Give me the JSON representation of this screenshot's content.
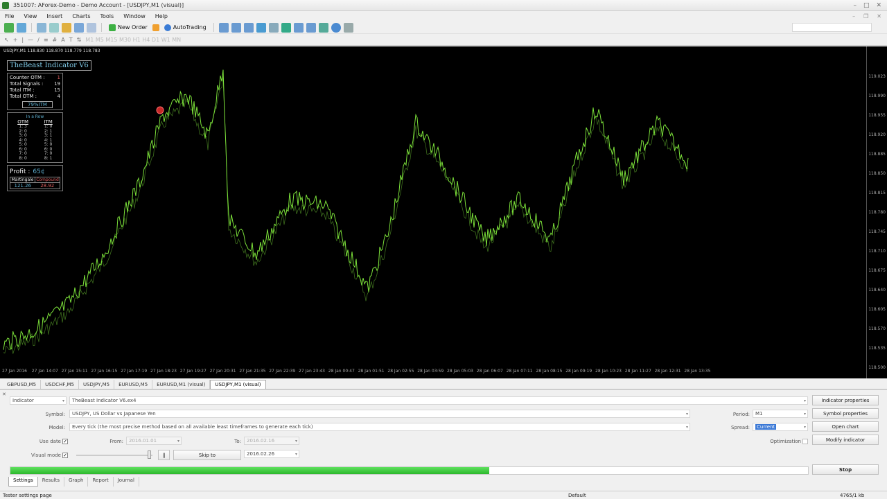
{
  "window": {
    "title": "351007: AForex-Demo - Demo Account - [USDJPY,M1 (visual)]"
  },
  "menu": [
    "File",
    "View",
    "Insert",
    "Charts",
    "Tools",
    "Window",
    "Help"
  ],
  "toolbar": {
    "new_order": "New Order",
    "autotrading": "AutoTrading"
  },
  "chart": {
    "title": "USDJPY,M1  118.830 118.870 118.779 118.783",
    "price_labels": [
      "119.023",
      "118.990",
      "118.955",
      "118.920",
      "118.885",
      "118.850",
      "118.815",
      "118.780",
      "118.745",
      "118.710",
      "118.675",
      "118.640",
      "118.605",
      "118.570",
      "118.535",
      "118.500"
    ],
    "time_labels": [
      "27 Jan 2016",
      "27 Jan 14:07",
      "27 Jan 15:11",
      "27 Jan 16:15",
      "27 Jan 17:19",
      "27 Jan 18:23",
      "27 Jan 19:27",
      "27 Jan 20:31",
      "27 Jan 21:35",
      "27 Jan 22:39",
      "27 Jan 23:43",
      "28 Jan 00:47",
      "28 Jan 01:51",
      "28 Jan 02:55",
      "28 Jan 03:59",
      "28 Jan 05:03",
      "28 Jan 06:07",
      "28 Jan 07:11",
      "28 Jan 08:15",
      "28 Jan 09:19",
      "28 Jan 10:23",
      "28 Jan 11:27",
      "28 Jan 12:31",
      "28 Jan 13:35"
    ],
    "line_color": "#7ce23a"
  },
  "indicator": {
    "title": "TheBeast Indicator V6",
    "counter_otm_label": "Counter OTM :",
    "counter_otm_value": "1",
    "total_signals_label": "Total Signals :",
    "total_signals_value": "19",
    "total_itm_label": "Total ITM :",
    "total_itm_value": "15",
    "total_otm_label": "Total OTM :",
    "total_otm_value": "4",
    "itm_pct": "79%ITM",
    "in_a_row": "In a Row",
    "otm_header": "OTM",
    "itm_header": "ITM",
    "otm_rows": [
      "1: 3",
      "2: 0",
      "3: 0",
      "4: 0",
      "5: 0",
      "6: 0",
      "7: 0",
      "8: 0"
    ],
    "itm_rows": [
      "1: 0",
      "2: 1",
      "3: 1",
      "4: 1",
      "5: 0",
      "6: 0",
      "7: 0",
      "8: 1"
    ],
    "profit_label": "Profit :",
    "profit_value": "65¢",
    "martingale_label": "Martingale",
    "compound_label": "Compound",
    "martingale_value": "121.26",
    "compound_value": "28.92"
  },
  "symbol_tabs": [
    "GBPUSD,M5",
    "USDCHF,M5",
    "USDJPY,M5",
    "EURUSD,M5",
    "EURUSD,M1 (visual)",
    "USDJPY,M1 (visual)"
  ],
  "tester": {
    "type": "Indicator",
    "expert": "TheBeast Indicator V6.ex4",
    "symbol_label": "Symbol:",
    "symbol": "USDJPY, US Dollar vs Japanese Yen",
    "model_label": "Model:",
    "model": "Every tick (the most precise method based on all available least timeframes to generate each tick)",
    "use_date_label": "Use date",
    "from_label": "From:",
    "from": "2016.01.01",
    "to_label": "To:",
    "to": "2016.02.16",
    "visual_mode_label": "Visual mode",
    "pause": "||",
    "skip_to_label": "Skip to",
    "skip_to": "2016.02.26",
    "period_label": "Period:",
    "period": "M1",
    "spread_label": "Spread:",
    "spread": "Current",
    "optimization_label": "Optimization",
    "btn_indicator_props": "Indicator properties",
    "btn_symbol_props": "Symbol properties",
    "btn_open_chart": "Open chart",
    "btn_modify": "Modify indicator",
    "btn_stop": "Stop",
    "progress": 0.6
  },
  "bottom_tabs": [
    "Settings",
    "Results",
    "Graph",
    "Report",
    "Journal"
  ],
  "status": {
    "left": "Tester settings page",
    "middle": "Default",
    "right": "4765/1 kb"
  }
}
